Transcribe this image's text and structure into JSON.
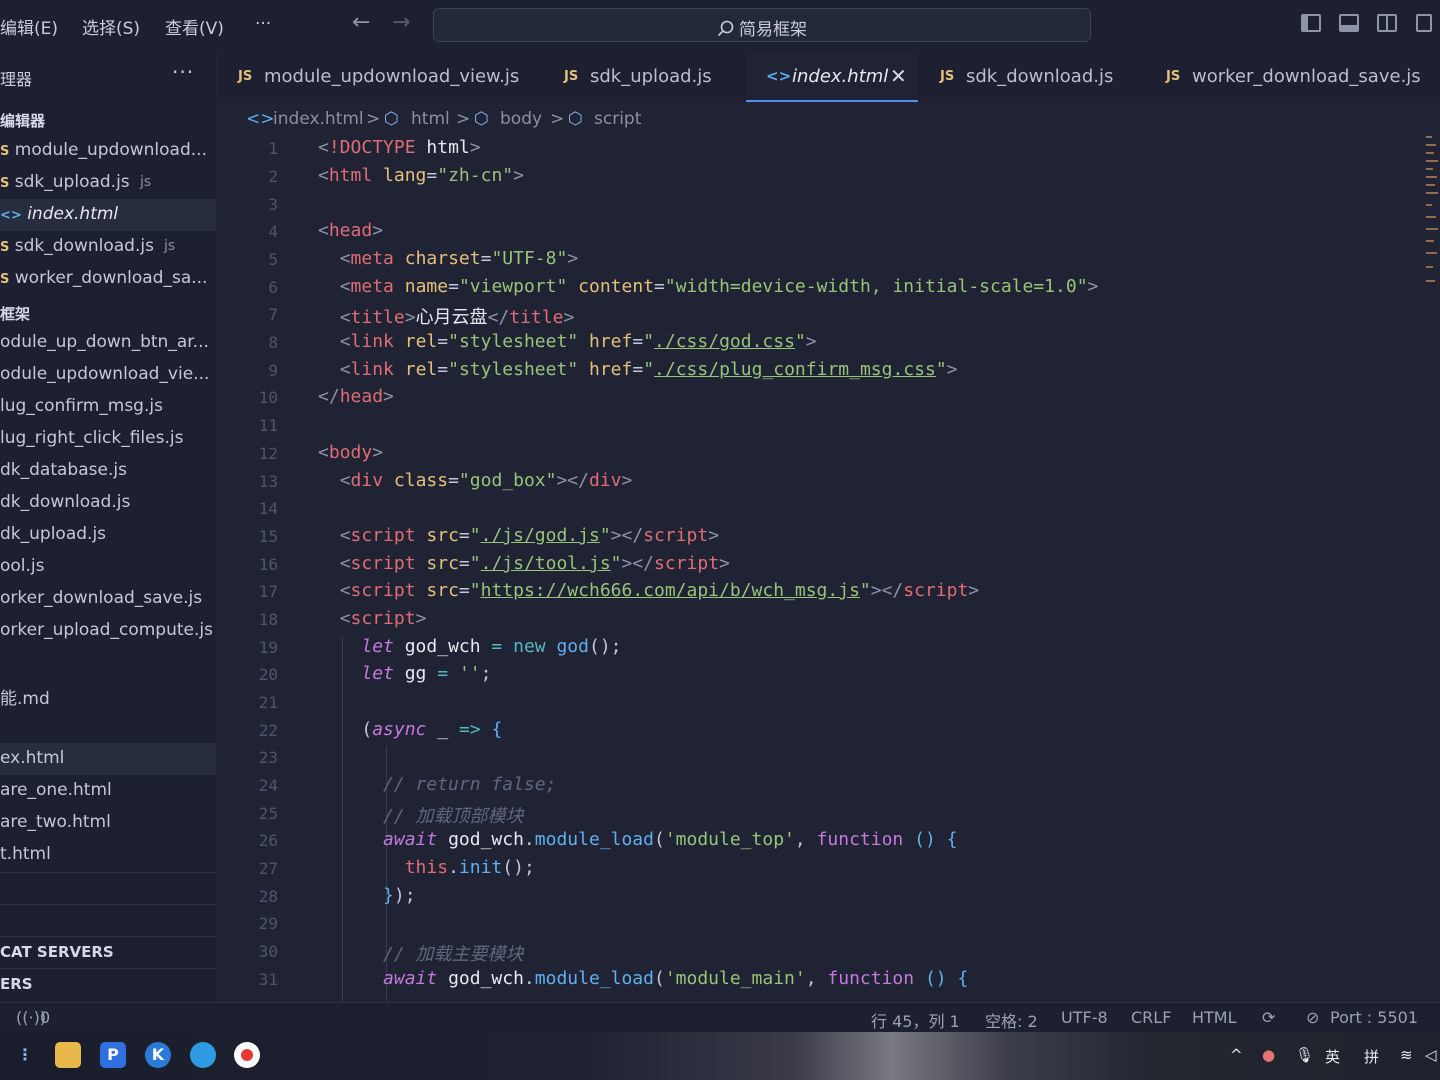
{
  "menubar": {
    "items": [
      "编辑(E)",
      "选择(S)",
      "查看(V)",
      "···"
    ],
    "search": "简易框架"
  },
  "sidebar": {
    "header": "理器",
    "open_editors_title": "编辑器",
    "open_editors": [
      {
        "label": "module_updownload...",
        "suffix": ""
      },
      {
        "label": "sdk_upload.js",
        "suffix": "js"
      },
      {
        "label": "index.html",
        "suffix": ""
      },
      {
        "label": "sdk_download.js",
        "suffix": "js"
      },
      {
        "label": "worker_download_sa...",
        "suffix": ""
      }
    ],
    "folder_title": "框架",
    "files": [
      "odule_up_down_btn_ar...",
      "odule_updownload_vie...",
      "lug_confirm_msg.js",
      "lug_right_click_files.js",
      "dk_database.js",
      "dk_download.js",
      "dk_upload.js",
      "ool.js",
      "orker_download_save.js",
      "orker_upload_compute.js",
      "",
      "能.md",
      "",
      "ex.html",
      "are_one.html",
      "are_two.html",
      "t.html"
    ],
    "bottom_sections": [
      "",
      "CAT SERVERS",
      "ERS"
    ]
  },
  "tabs": [
    {
      "label": "module_updownload_view.js",
      "icon": "JS"
    },
    {
      "label": "sdk_upload.js",
      "icon": "JS"
    },
    {
      "label": "index.html",
      "icon": "<>"
    },
    {
      "label": "sdk_download.js",
      "icon": "JS"
    },
    {
      "label": "worker_download_save.js",
      "icon": "JS"
    }
  ],
  "breadcrumb": [
    "index.html",
    "html",
    "body",
    "script"
  ],
  "editor": {
    "line_numbers": [
      "1",
      "2",
      "3",
      "4",
      "5",
      "6",
      "7",
      "8",
      "9",
      "10",
      "11",
      "12",
      "13",
      "14",
      "15",
      "16",
      "17",
      "18",
      "19",
      "20",
      "21",
      "22",
      "23",
      "24",
      "25",
      "26",
      "27",
      "28",
      "29",
      "30",
      "31"
    ],
    "strings": {
      "doctype": "<!DOCTYPE html>",
      "lang": "zh-cn",
      "charset": "UTF-8",
      "viewport": "viewport",
      "viewport_content": "width=device-width, initial-scale=1.0",
      "title": "心月云盘",
      "stylesheet": "stylesheet",
      "css1": "./css/god.css",
      "css2": "./css/plug_confirm_msg.css",
      "div_class": "god_box",
      "js1": "./js/god.js",
      "js2": "./js/tool.js",
      "js3": "https://wch666.com/api/b/wch_msg.js",
      "cmt1": "// return false;",
      "cmt2": "// 加载顶部模块",
      "mod_top": "'module_top'",
      "cmt3": "// 加载主要模块",
      "mod_main": "'module_main'",
      "empty_str": "''"
    }
  },
  "statusbar": {
    "remote": "0",
    "position": "行 45，列 1",
    "indent": "空格: 2",
    "encoding": "UTF-8",
    "eol": "CRLF",
    "language": "HTML",
    "port": "Port : 5501"
  },
  "taskbar": {
    "apps": [
      "P",
      "K"
    ],
    "ime_lang": "英",
    "ime_mode": "拼"
  }
}
